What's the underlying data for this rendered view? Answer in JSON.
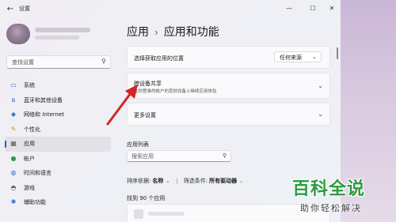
{
  "window": {
    "app_title": "设置",
    "controls": {
      "minimize": "—",
      "maximize": "☐",
      "close": "✕"
    }
  },
  "sidebar": {
    "search_placeholder": "查找设置",
    "items": [
      {
        "label": "系统",
        "icon": "monitor-icon",
        "active": false
      },
      {
        "label": "蓝牙和其他设备",
        "icon": "bluetooth-icon",
        "active": false
      },
      {
        "label": "网络和 Internet",
        "icon": "network-icon",
        "active": false
      },
      {
        "label": "个性化",
        "icon": "brush-icon",
        "active": false
      },
      {
        "label": "应用",
        "icon": "apps-icon",
        "active": true
      },
      {
        "label": "帐户",
        "icon": "account-icon",
        "active": false
      },
      {
        "label": "时间和语言",
        "icon": "globe-clock-icon",
        "active": false
      },
      {
        "label": "游戏",
        "icon": "gamepad-icon",
        "active": false
      },
      {
        "label": "辅助功能",
        "icon": "accessibility-icon",
        "active": false
      }
    ]
  },
  "main": {
    "breadcrumb_parent": "应用",
    "breadcrumb_current": "应用和功能",
    "install_source": {
      "label": "选择获取应用的位置",
      "selected": "任何来源"
    },
    "cross_device": {
      "title": "跨设备共享",
      "subtitle": "在你登录的帐户的其他设备上继续应用体验"
    },
    "more_settings": "更多设置",
    "app_list_label": "应用列表",
    "app_search_placeholder": "搜索应用",
    "sort": {
      "label": "排序依据:",
      "value": "名称"
    },
    "filter": {
      "label": "筛选条件:",
      "value": "所有驱动器"
    },
    "found_count": "找到 90 个应用"
  },
  "watermark": {
    "title": "百科全说",
    "subtitle": "助你轻松解决"
  },
  "colors": {
    "accent": "#1f5fbf",
    "arrow": "#d42424",
    "watermark_green": "#2b9b3e"
  }
}
